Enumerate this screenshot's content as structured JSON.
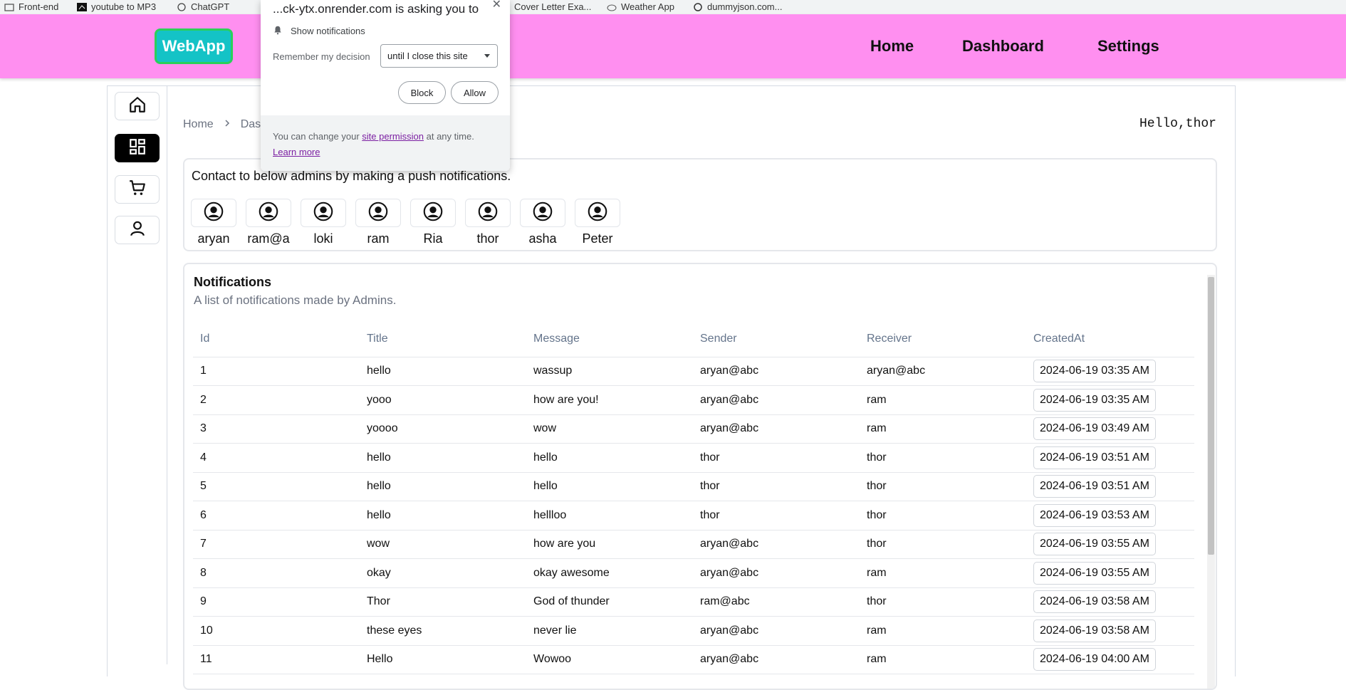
{
  "bookmarks": [
    "Front-end",
    "youtube to MP3",
    "ChatGPT",
    "Cover Letter Exa...",
    "Weather App",
    "dummyjson.com..."
  ],
  "brand": "WebApp",
  "nav": {
    "home": "Home",
    "dashboard": "Dashboard",
    "settings": "Settings"
  },
  "sidebar_icons": [
    "home-icon",
    "dashboard-icon",
    "cart-icon",
    "user-icon"
  ],
  "breadcrumb": {
    "home": "Home",
    "current": "Das"
  },
  "greeting": "Hello,thor",
  "contact": {
    "text": "Contact to below admins by making a push notifications.",
    "admins": [
      "aryan",
      "ram@a",
      "loki",
      "ram",
      "Ria",
      "thor",
      "asha",
      "Peter"
    ]
  },
  "notifications": {
    "title": "Notifications",
    "subtitle": "A list of notifications made by Admins.",
    "columns": [
      "Id",
      "Title",
      "Message",
      "Sender",
      "Receiver",
      "CreatedAt"
    ],
    "rows": [
      [
        "1",
        "hello",
        "wassup",
        "aryan@abc",
        "aryan@abc",
        "2024-06-19 03:35 AM"
      ],
      [
        "2",
        "yooo",
        "how are you!",
        "aryan@abc",
        "ram",
        "2024-06-19 03:35 AM"
      ],
      [
        "3",
        "yoooo",
        "wow",
        "aryan@abc",
        "ram",
        "2024-06-19 03:49 AM"
      ],
      [
        "4",
        "hello",
        "hello",
        "thor",
        "thor",
        "2024-06-19 03:51 AM"
      ],
      [
        "5",
        "hello",
        "hello",
        "thor",
        "thor",
        "2024-06-19 03:51 AM"
      ],
      [
        "6",
        "hello",
        "hellloo",
        "thor",
        "thor",
        "2024-06-19 03:53 AM"
      ],
      [
        "7",
        "wow",
        "how are you",
        "aryan@abc",
        "thor",
        "2024-06-19 03:55 AM"
      ],
      [
        "8",
        "okay",
        "okay awesome",
        "aryan@abc",
        "ram",
        "2024-06-19 03:55 AM"
      ],
      [
        "9",
        "Thor",
        "God of thunder",
        "ram@abc",
        "thor",
        "2024-06-19 03:58 AM"
      ],
      [
        "10",
        "these eyes",
        "never lie",
        "aryan@abc",
        "ram",
        "2024-06-19 03:58 AM"
      ],
      [
        "11",
        "Hello",
        "Wowoo",
        "aryan@abc",
        "ram",
        "2024-06-19 04:00 AM"
      ]
    ]
  },
  "permission_popup": {
    "title": "...ck-ytx.onrender.com is asking you to",
    "show": "Show notifications",
    "remember_label": "Remember my decision",
    "remember_value": "until I close this site",
    "block": "Block",
    "allow": "Allow",
    "footer_prefix": "You can change your",
    "footer_link": "site permission",
    "footer_suffix": "at any time.",
    "learn_more": "Learn more"
  },
  "colors": {
    "navbar": "#ff8ff0",
    "logo_bg": "#14c3c6",
    "logo_border": "#2ad05a"
  }
}
